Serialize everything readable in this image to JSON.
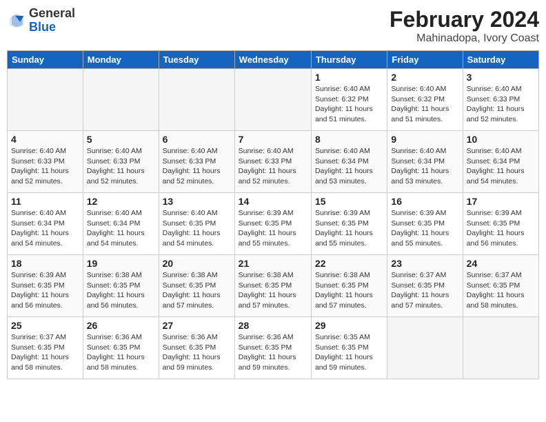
{
  "header": {
    "logo_general": "General",
    "logo_blue": "Blue",
    "month_year": "February 2024",
    "location": "Mahinadopa, Ivory Coast"
  },
  "weekdays": [
    "Sunday",
    "Monday",
    "Tuesday",
    "Wednesday",
    "Thursday",
    "Friday",
    "Saturday"
  ],
  "weeks": [
    [
      {
        "day": "",
        "info": ""
      },
      {
        "day": "",
        "info": ""
      },
      {
        "day": "",
        "info": ""
      },
      {
        "day": "",
        "info": ""
      },
      {
        "day": "1",
        "info": "Sunrise: 6:40 AM\nSunset: 6:32 PM\nDaylight: 11 hours and 51 minutes."
      },
      {
        "day": "2",
        "info": "Sunrise: 6:40 AM\nSunset: 6:32 PM\nDaylight: 11 hours and 51 minutes."
      },
      {
        "day": "3",
        "info": "Sunrise: 6:40 AM\nSunset: 6:33 PM\nDaylight: 11 hours and 52 minutes."
      }
    ],
    [
      {
        "day": "4",
        "info": "Sunrise: 6:40 AM\nSunset: 6:33 PM\nDaylight: 11 hours and 52 minutes."
      },
      {
        "day": "5",
        "info": "Sunrise: 6:40 AM\nSunset: 6:33 PM\nDaylight: 11 hours and 52 minutes."
      },
      {
        "day": "6",
        "info": "Sunrise: 6:40 AM\nSunset: 6:33 PM\nDaylight: 11 hours and 52 minutes."
      },
      {
        "day": "7",
        "info": "Sunrise: 6:40 AM\nSunset: 6:33 PM\nDaylight: 11 hours and 52 minutes."
      },
      {
        "day": "8",
        "info": "Sunrise: 6:40 AM\nSunset: 6:34 PM\nDaylight: 11 hours and 53 minutes."
      },
      {
        "day": "9",
        "info": "Sunrise: 6:40 AM\nSunset: 6:34 PM\nDaylight: 11 hours and 53 minutes."
      },
      {
        "day": "10",
        "info": "Sunrise: 6:40 AM\nSunset: 6:34 PM\nDaylight: 11 hours and 54 minutes."
      }
    ],
    [
      {
        "day": "11",
        "info": "Sunrise: 6:40 AM\nSunset: 6:34 PM\nDaylight: 11 hours and 54 minutes."
      },
      {
        "day": "12",
        "info": "Sunrise: 6:40 AM\nSunset: 6:34 PM\nDaylight: 11 hours and 54 minutes."
      },
      {
        "day": "13",
        "info": "Sunrise: 6:40 AM\nSunset: 6:35 PM\nDaylight: 11 hours and 54 minutes."
      },
      {
        "day": "14",
        "info": "Sunrise: 6:39 AM\nSunset: 6:35 PM\nDaylight: 11 hours and 55 minutes."
      },
      {
        "day": "15",
        "info": "Sunrise: 6:39 AM\nSunset: 6:35 PM\nDaylight: 11 hours and 55 minutes."
      },
      {
        "day": "16",
        "info": "Sunrise: 6:39 AM\nSunset: 6:35 PM\nDaylight: 11 hours and 55 minutes."
      },
      {
        "day": "17",
        "info": "Sunrise: 6:39 AM\nSunset: 6:35 PM\nDaylight: 11 hours and 56 minutes."
      }
    ],
    [
      {
        "day": "18",
        "info": "Sunrise: 6:39 AM\nSunset: 6:35 PM\nDaylight: 11 hours and 56 minutes."
      },
      {
        "day": "19",
        "info": "Sunrise: 6:38 AM\nSunset: 6:35 PM\nDaylight: 11 hours and 56 minutes."
      },
      {
        "day": "20",
        "info": "Sunrise: 6:38 AM\nSunset: 6:35 PM\nDaylight: 11 hours and 57 minutes."
      },
      {
        "day": "21",
        "info": "Sunrise: 6:38 AM\nSunset: 6:35 PM\nDaylight: 11 hours and 57 minutes."
      },
      {
        "day": "22",
        "info": "Sunrise: 6:38 AM\nSunset: 6:35 PM\nDaylight: 11 hours and 57 minutes."
      },
      {
        "day": "23",
        "info": "Sunrise: 6:37 AM\nSunset: 6:35 PM\nDaylight: 11 hours and 57 minutes."
      },
      {
        "day": "24",
        "info": "Sunrise: 6:37 AM\nSunset: 6:35 PM\nDaylight: 11 hours and 58 minutes."
      }
    ],
    [
      {
        "day": "25",
        "info": "Sunrise: 6:37 AM\nSunset: 6:35 PM\nDaylight: 11 hours and 58 minutes."
      },
      {
        "day": "26",
        "info": "Sunrise: 6:36 AM\nSunset: 6:35 PM\nDaylight: 11 hours and 58 minutes."
      },
      {
        "day": "27",
        "info": "Sunrise: 6:36 AM\nSunset: 6:35 PM\nDaylight: 11 hours and 59 minutes."
      },
      {
        "day": "28",
        "info": "Sunrise: 6:36 AM\nSunset: 6:35 PM\nDaylight: 11 hours and 59 minutes."
      },
      {
        "day": "29",
        "info": "Sunrise: 6:35 AM\nSunset: 6:35 PM\nDaylight: 11 hours and 59 minutes."
      },
      {
        "day": "",
        "info": ""
      },
      {
        "day": "",
        "info": ""
      }
    ]
  ]
}
